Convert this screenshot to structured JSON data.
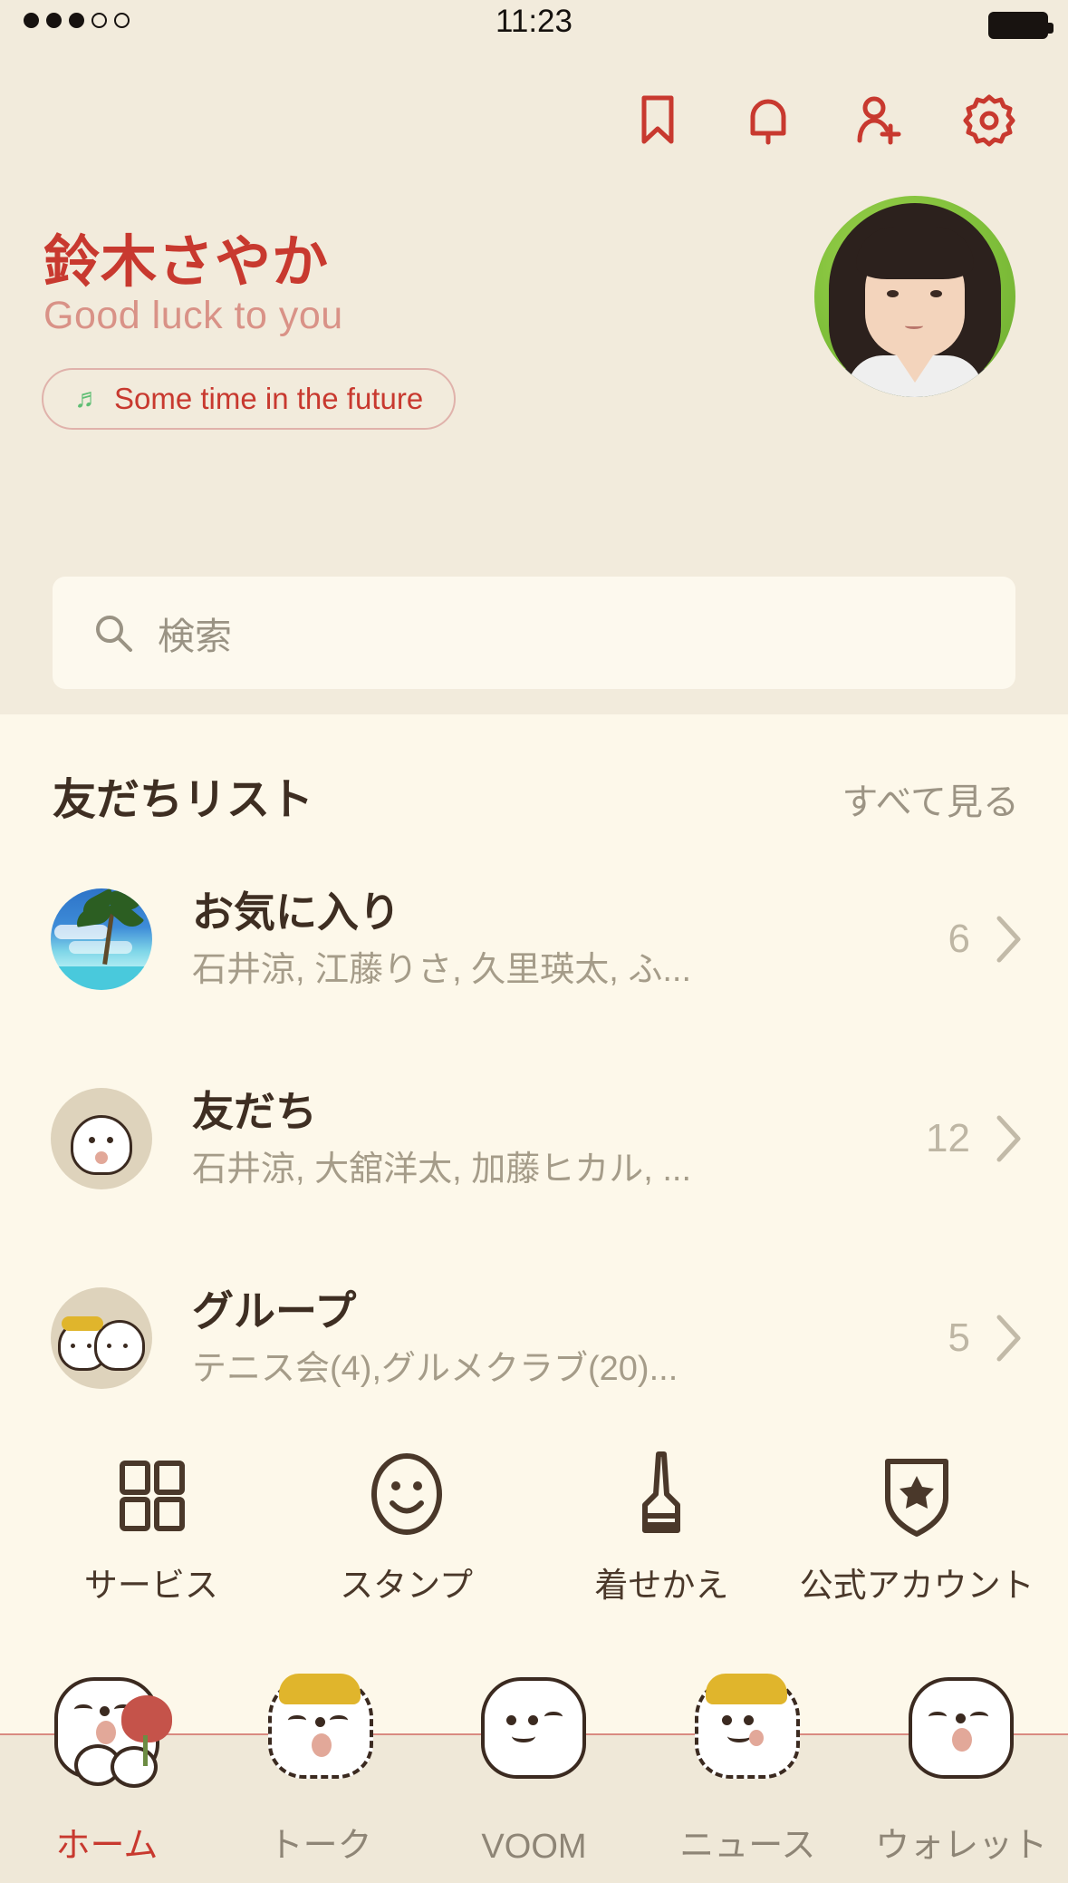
{
  "statusbar": {
    "time": "11:23",
    "signal_dots_filled": 3,
    "signal_dots_total": 5
  },
  "header": {
    "icons": [
      {
        "name": "bookmark-icon",
        "label": "bookmark"
      },
      {
        "name": "bell-icon",
        "label": "notifications"
      },
      {
        "name": "add-friend-icon",
        "label": "add friend"
      },
      {
        "name": "gear-icon",
        "label": "settings"
      }
    ],
    "profile_name": "鈴木さやか",
    "status_message": "Good luck to you",
    "music_note_icon": "music-note-icon",
    "music_label": "Some time in the future",
    "avatar_name": "profile-avatar",
    "accent_color": "#C8392F",
    "status_color": "#D99287",
    "background_color": "#F2EBDC"
  },
  "search": {
    "icon": "search-icon",
    "placeholder": "検索",
    "value": ""
  },
  "friends": {
    "title": "友だちリスト",
    "see_all": "すべて見る",
    "rows": [
      {
        "avatar": "beach-avatar",
        "title": "お気に入り",
        "subtitle": "石井涼, 江藤りさ, 久里瑛太, ふ...",
        "count": "6"
      },
      {
        "avatar": "dog-avatar",
        "title": "友だち",
        "subtitle": "石井涼, 大舘洋太, 加藤ヒカル, ...",
        "count": "12"
      },
      {
        "avatar": "group-avatar",
        "title": "グループ",
        "subtitle": "テニス会(4),グルメクラブ(20)...",
        "count": "5"
      }
    ]
  },
  "shortcuts": [
    {
      "icon": "grid-icon",
      "label": "サービス"
    },
    {
      "icon": "smiley-icon",
      "label": "スタンプ"
    },
    {
      "icon": "brush-icon",
      "label": "着せかえ"
    },
    {
      "icon": "shield-star-icon",
      "label": "公式アカウント"
    }
  ],
  "bottom_nav": {
    "active_index": 0,
    "active_color": "#C8392F",
    "inactive_color": "#8E8576",
    "items": [
      {
        "icon": "dog-flower-icon",
        "label": "ホーム"
      },
      {
        "icon": "dog-blonde-icon",
        "label": "トーク"
      },
      {
        "icon": "dog-smile-icon",
        "label": "VOOM"
      },
      {
        "icon": "dog-blonde2-icon",
        "label": "ニュース"
      },
      {
        "icon": "dog-oh-icon",
        "label": "ウォレット"
      }
    ]
  }
}
